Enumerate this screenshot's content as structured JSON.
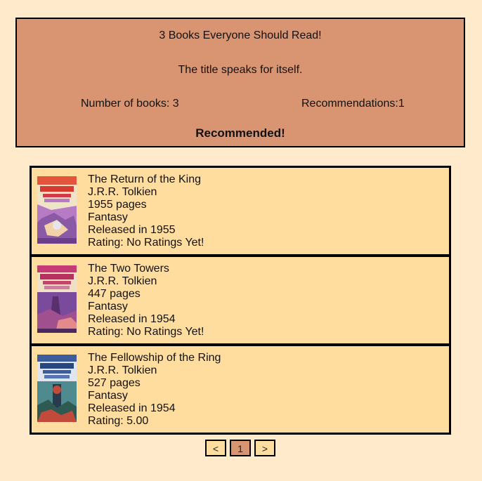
{
  "list": {
    "title": "3 Books Everyone Should Read!",
    "description": "The title speaks for itself.",
    "book_count": "Number of books: 3",
    "recommendations": "Recommendations:1",
    "recommended_label": "Recommended!"
  },
  "books": [
    {
      "title": "The Return of the King",
      "author": "J.R.R. Tolkien",
      "pages": "1955 pages",
      "genre": "Fantasy",
      "released": "Released in 1955",
      "rating": "Rating: No Ratings Yet!",
      "cover_icon": "book-cover-image",
      "cover_colors": [
        "#e2553c",
        "#b77ac4",
        "#f3d2a8"
      ]
    },
    {
      "title": "The Two Towers",
      "author": "J.R.R. Tolkien",
      "pages": "447 pages",
      "genre": "Fantasy",
      "released": "Released in 1954",
      "rating": "Rating: No Ratings Yet!",
      "cover_icon": "book-cover-image",
      "cover_colors": [
        "#c53c74",
        "#7a4a9c",
        "#e48a8a"
      ]
    },
    {
      "title": "The Fellowship of the Ring",
      "author": "J.R.R. Tolkien",
      "pages": "527 pages",
      "genre": "Fantasy",
      "released": "Released in 1954",
      "rating": "Rating: 5.00",
      "cover_icon": "book-cover-image",
      "cover_colors": [
        "#3b5d9e",
        "#c24a3a",
        "#4e8a8e"
      ]
    }
  ],
  "pagination": {
    "prev_label": "<",
    "current_page": "1",
    "next_label": ">"
  },
  "colors": {
    "page_background": "#ffebcc",
    "header_background": "#d99571",
    "book_background": "#ffdd9f"
  }
}
